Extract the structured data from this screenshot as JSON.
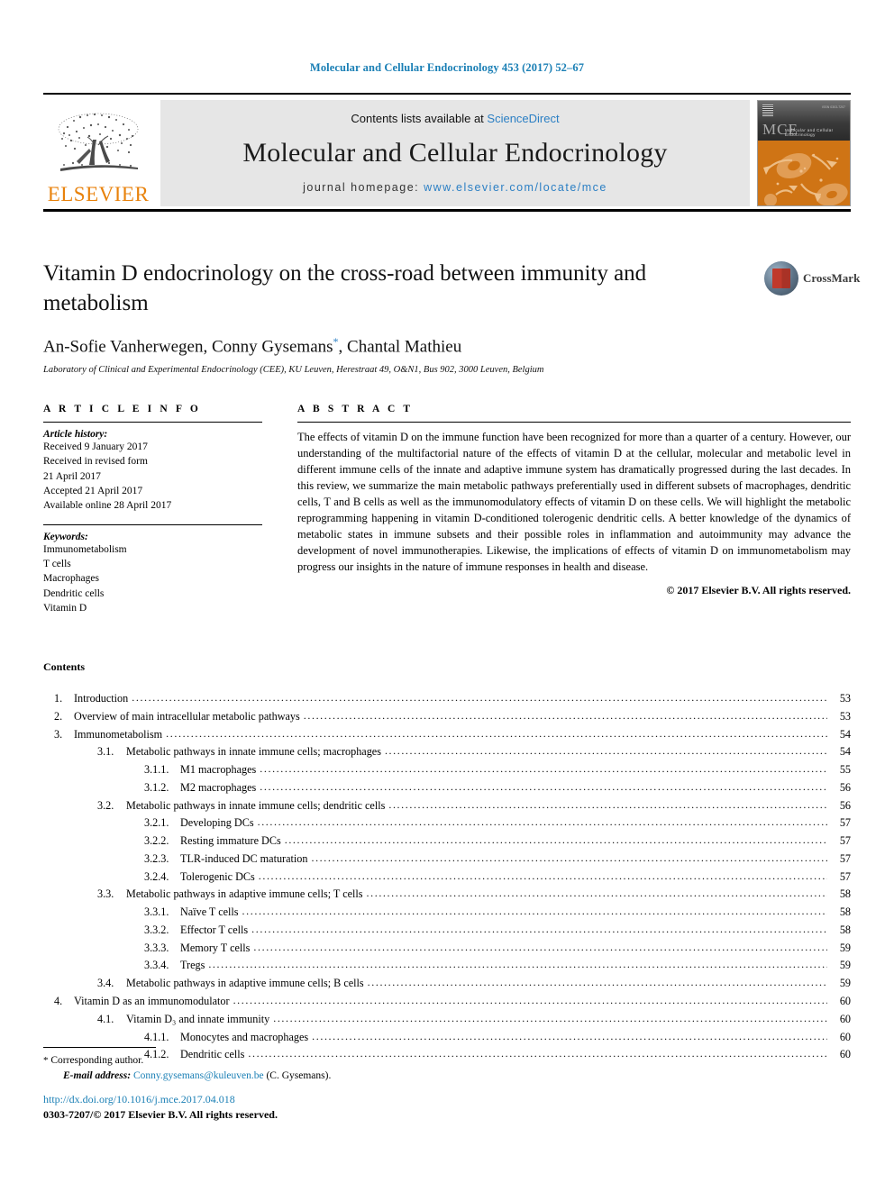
{
  "running_head": "Molecular and Cellular Endocrinology 453 (2017) 52–67",
  "masthead": {
    "publisher_name": "ELSEVIER",
    "contents_prefix": "Contents lists available at ",
    "sciencedirect": "ScienceDirect",
    "journal_name": "Molecular and Cellular Endocrinology",
    "homepage_label": "journal homepage: ",
    "homepage_url": "www.elsevier.com/locate/mce",
    "cover_abbrev": "MCE",
    "cover_subtitle": "Molecular and Cellular Endocrinology",
    "cover_issn": "ISSN 0303-7207",
    "accent_blue": "#2b7fc4",
    "elsevier_orange": "#e8820c",
    "panel_gray": "#e6e6e6"
  },
  "article": {
    "title": "Vitamin D endocrinology on the cross-road between immunity and metabolism",
    "authors": "An-Sofie Vanherwegen, Conny Gysemans",
    "author_marker": "*",
    "authors_tail": ", Chantal Mathieu",
    "affiliation": "Laboratory of Clinical and Experimental Endocrinology (CEE), KU Leuven, Herestraat 49, O&N1, Bus 902, 3000 Leuven, Belgium",
    "crossmark_label": "CrossMark"
  },
  "article_info": {
    "heading": "A R T I C L E   I N F O",
    "history_label": "Article history:",
    "history_lines": [
      "Received 9 January 2017",
      "Received in revised form",
      "21 April 2017",
      "Accepted 21 April 2017",
      "Available online 28 April 2017"
    ],
    "keywords_label": "Keywords:",
    "keywords": [
      "Immunometabolism",
      "T cells",
      "Macrophages",
      "Dendritic cells",
      "Vitamin D"
    ]
  },
  "abstract": {
    "heading": "A B S T R A C T",
    "body": "The effects of vitamin D on the immune function have been recognized for more than a quarter of a century. However, our understanding of the multifactorial nature of the effects of vitamin D at the cellular, molecular and metabolic level in different immune cells of the innate and adaptive immune system has dramatically progressed during the last decades. In this review, we summarize the main metabolic pathways preferentially used in different subsets of macrophages, dendritic cells, T and B cells as well as the immunomodulatory effects of vitamin D on these cells. We will highlight the metabolic reprogramming happening in vitamin D-conditioned tolerogenic dendritic cells. A better knowledge of the dynamics of metabolic states in immune subsets and their possible roles in inflammation and autoimmunity may advance the development of novel immunotherapies. Likewise, the implications of effects of vitamin D on immunometabolism may progress our insights in the nature of immune responses in health and disease.",
    "copyright": "© 2017 Elsevier B.V. All rights reserved."
  },
  "contents": {
    "title": "Contents",
    "items": [
      {
        "level": 1,
        "num": "1.",
        "label": "Introduction",
        "page": "53"
      },
      {
        "level": 1,
        "num": "2.",
        "label": "Overview of main intracellular metabolic pathways",
        "page": "53"
      },
      {
        "level": 1,
        "num": "3.",
        "label": "Immunometabolism",
        "page": "54"
      },
      {
        "level": 2,
        "num": "3.1.",
        "label": "Metabolic pathways in innate immune cells; macrophages",
        "page": "54"
      },
      {
        "level": 3,
        "num": "3.1.1.",
        "label": "M1 macrophages",
        "page": "55"
      },
      {
        "level": 3,
        "num": "3.1.2.",
        "label": "M2 macrophages",
        "page": "56"
      },
      {
        "level": 2,
        "num": "3.2.",
        "label": "Metabolic pathways in innate immune cells; dendritic cells",
        "page": "56"
      },
      {
        "level": 3,
        "num": "3.2.1.",
        "label": "Developing DCs",
        "page": "57"
      },
      {
        "level": 3,
        "num": "3.2.2.",
        "label": "Resting immature DCs",
        "page": "57"
      },
      {
        "level": 3,
        "num": "3.2.3.",
        "label": "TLR-induced DC maturation",
        "page": "57"
      },
      {
        "level": 3,
        "num": "3.2.4.",
        "label": "Tolerogenic DCs",
        "page": "57"
      },
      {
        "level": 2,
        "num": "3.3.",
        "label": "Metabolic pathways in adaptive immune cells; T cells",
        "page": "58"
      },
      {
        "level": 3,
        "num": "3.3.1.",
        "label": "Naïve T cells",
        "page": "58"
      },
      {
        "level": 3,
        "num": "3.3.2.",
        "label": "Effector T cells",
        "page": "58"
      },
      {
        "level": 3,
        "num": "3.3.3.",
        "label": "Memory T cells",
        "page": "59"
      },
      {
        "level": 3,
        "num": "3.3.4.",
        "label": "Tregs",
        "page": "59"
      },
      {
        "level": 2,
        "num": "3.4.",
        "label": "Metabolic pathways in adaptive immune cells; B cells",
        "page": "59"
      },
      {
        "level": 1,
        "num": "4.",
        "label": "Vitamin D as an immunomodulator",
        "page": "60"
      },
      {
        "level": 2,
        "num": "4.1.",
        "label": "Vitamin D₃ and innate immunity",
        "page": "60"
      },
      {
        "level": 3,
        "num": "4.1.1.",
        "label": "Monocytes and macrophages",
        "page": "60"
      },
      {
        "level": 3,
        "num": "4.1.2.",
        "label": "Dendritic cells",
        "page": "60"
      }
    ]
  },
  "footnotes": {
    "corresponding": "Corresponding author.",
    "email_label": "E-mail address:",
    "email": "Conny.gysemans@kuleuven.be",
    "email_suffix": "(C. Gysemans).",
    "doi": "http://dx.doi.org/10.1016/j.mce.2017.04.018",
    "issn_line": "0303-7207/© 2017 Elsevier B.V. All rights reserved."
  }
}
